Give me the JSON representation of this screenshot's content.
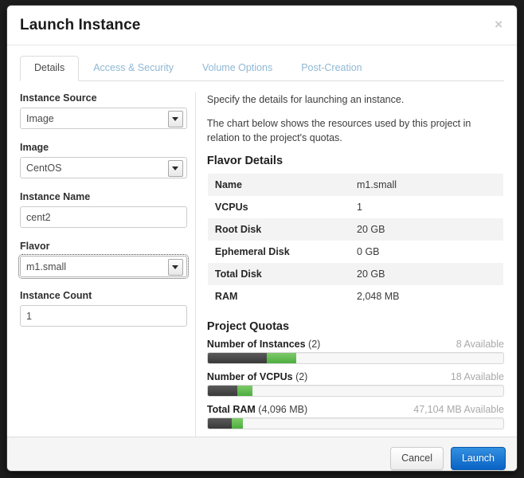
{
  "dialog": {
    "title": "Launch Instance",
    "close_label": "×"
  },
  "tabs": [
    {
      "label": "Details",
      "active": true
    },
    {
      "label": "Access & Security",
      "active": false
    },
    {
      "label": "Volume Options",
      "active": false
    },
    {
      "label": "Post-Creation",
      "active": false
    }
  ],
  "form": {
    "instance_source": {
      "label": "Instance Source",
      "value": "Image"
    },
    "image": {
      "label": "Image",
      "value": "CentOS"
    },
    "instance_name": {
      "label": "Instance Name",
      "value": "cent2",
      "placeholder": ""
    },
    "flavor": {
      "label": "Flavor",
      "value": "m1.small",
      "focused": true
    },
    "instance_count": {
      "label": "Instance Count",
      "value": "1",
      "placeholder": ""
    }
  },
  "info": {
    "paragraph1": "Specify the details for launching an instance.",
    "paragraph2": "The chart below shows the resources used by this project in relation to the project's quotas."
  },
  "flavor_details": {
    "title": "Flavor Details",
    "rows": [
      {
        "key": "Name",
        "value": "m1.small"
      },
      {
        "key": "VCPUs",
        "value": "1"
      },
      {
        "key": "Root Disk",
        "value": "20 GB"
      },
      {
        "key": "Ephemeral Disk",
        "value": "0 GB"
      },
      {
        "key": "Total Disk",
        "value": "20 GB"
      },
      {
        "key": "RAM",
        "value": "2,048 MB"
      }
    ]
  },
  "quotas": {
    "title": "Project Quotas",
    "items": [
      {
        "name": "Number of Instances",
        "count": "(2)",
        "available": "8 Available",
        "used_pct": 20,
        "added_pct": 10
      },
      {
        "name": "Number of VCPUs",
        "count": "(2)",
        "available": "18 Available",
        "used_pct": 10,
        "added_pct": 5
      },
      {
        "name": "Total RAM",
        "count": "(4,096 MB)",
        "available": "47,104 MB Available",
        "used_pct": 8,
        "added_pct": 4
      }
    ]
  },
  "footer": {
    "cancel_label": "Cancel",
    "launch_label": "Launch"
  },
  "colors": {
    "primary_button": "#0a63c6",
    "quota_used": "#393939",
    "quota_added": "#4cae3f",
    "tab_inactive": "#8fb8d4"
  }
}
